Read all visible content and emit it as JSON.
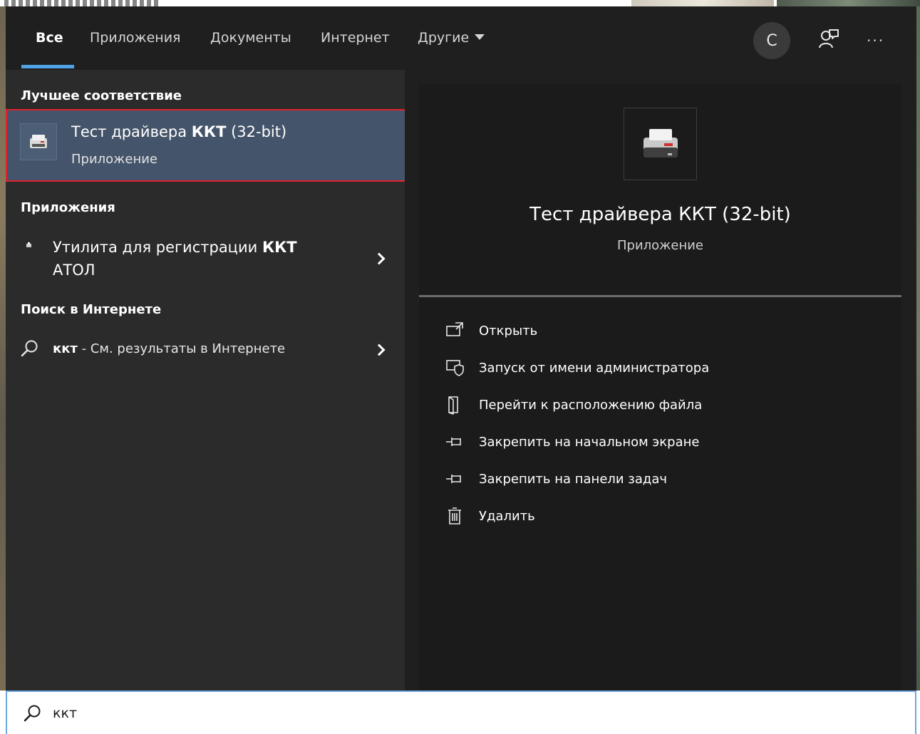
{
  "tabs": [
    {
      "label": "Все",
      "active": true
    },
    {
      "label": "Приложения",
      "active": false
    },
    {
      "label": "Документы",
      "active": false
    },
    {
      "label": "Интернет",
      "active": false
    },
    {
      "label": "Другие",
      "active": false
    }
  ],
  "header": {
    "avatar_initial": "С",
    "more_label": "···"
  },
  "best_match": {
    "heading": "Лучшее соответствие",
    "title_prefix": "Тест драйвера ",
    "title_bold": "ККТ",
    "title_suffix": " (32-bit)",
    "subtitle": "Приложение"
  },
  "apps": {
    "heading": "Приложения",
    "item": {
      "text_prefix": "Утилита для регистрации ",
      "text_bold": "ККТ",
      "text_line2": "АТОЛ"
    }
  },
  "web": {
    "heading": "Поиск в Интернете",
    "item": {
      "query": "ккт",
      "suffix": " - См. результаты в Интернете"
    }
  },
  "details": {
    "title": "Тест драйвера ККТ (32-bit)",
    "subtitle": "Приложение",
    "actions": [
      {
        "label": "Открыть",
        "icon": "open-icon"
      },
      {
        "label": "Запуск от имени администратора",
        "icon": "run-as-admin-icon"
      },
      {
        "label": "Перейти к расположению файла",
        "icon": "file-location-icon"
      },
      {
        "label": "Закрепить на начальном экране",
        "icon": "pin-icon"
      },
      {
        "label": "Закрепить на панели задач",
        "icon": "pin-icon"
      },
      {
        "label": "Удалить",
        "icon": "trash-icon"
      }
    ]
  },
  "search": {
    "value": "ккт"
  },
  "colors": {
    "accent": "#4ea3e6",
    "highlight": "#44546a",
    "selection_border": "#e0212c"
  }
}
